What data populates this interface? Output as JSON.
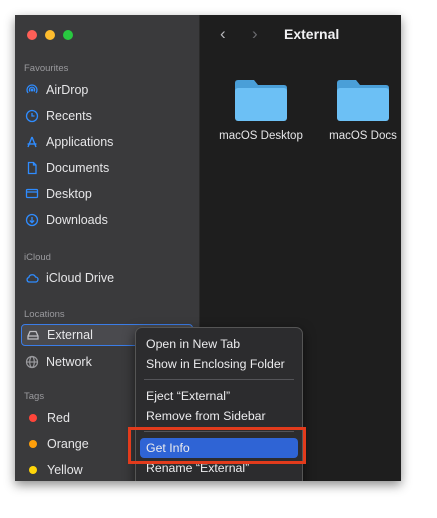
{
  "sidebar": {
    "favourites_label": "Favourites",
    "favourites": [
      {
        "label": "AirDrop",
        "icon": "airdrop-icon"
      },
      {
        "label": "Recents",
        "icon": "clock-icon"
      },
      {
        "label": "Applications",
        "icon": "applications-icon"
      },
      {
        "label": "Documents",
        "icon": "document-icon"
      },
      {
        "label": "Desktop",
        "icon": "desktop-icon"
      },
      {
        "label": "Downloads",
        "icon": "download-icon"
      }
    ],
    "icloud_label": "iCloud",
    "icloud": [
      {
        "label": "iCloud Drive",
        "icon": "cloud-icon"
      }
    ],
    "locations_label": "Locations",
    "locations": [
      {
        "label": "External",
        "icon": "drive-icon",
        "selected": true
      },
      {
        "label": "Network",
        "icon": "globe-icon"
      }
    ],
    "tags_label": "Tags",
    "tags": [
      {
        "label": "Red",
        "color": "#ff453a"
      },
      {
        "label": "Orange",
        "color": "#ff9f0a"
      },
      {
        "label": "Yellow",
        "color": "#ffd60a"
      }
    ]
  },
  "toolbar": {
    "title": "External"
  },
  "folders": [
    {
      "label": "macOS Desktop"
    },
    {
      "label": "macOS Docs"
    }
  ],
  "context_menu": {
    "items": [
      "Open in New Tab",
      "Show in Enclosing Folder",
      "Eject “External”",
      "Remove from Sidebar",
      "Get Info",
      "Rename “External”"
    ],
    "highlighted": "Get Info"
  },
  "colors": {
    "accent": "#2f8cff",
    "highlight": "#2f64d5",
    "annotation": "#e23b1c"
  }
}
